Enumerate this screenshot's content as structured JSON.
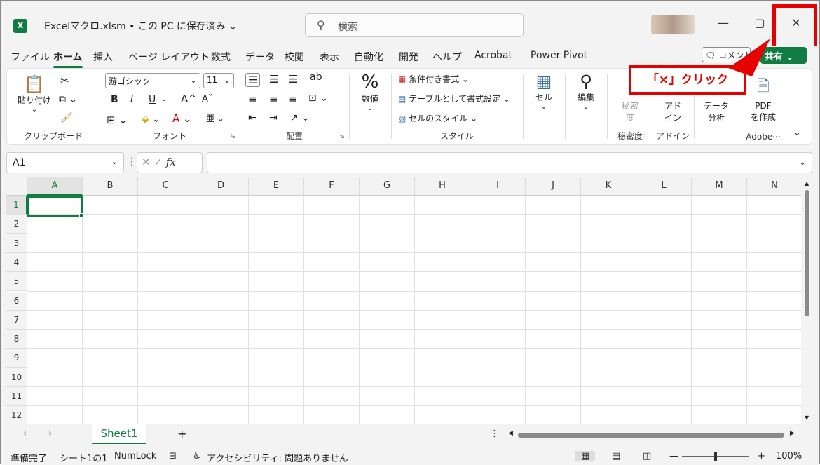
{
  "titlebar": {
    "app_icon": "X",
    "document_title": "Excelマクロ.xlsm • この PC に保存済み ⌄",
    "search_placeholder": "検索",
    "minimize": "—",
    "maximize": "▢",
    "close": "✕"
  },
  "menu": {
    "tabs": [
      "ファイル",
      "ホーム",
      "挿入",
      "ページ レイアウト",
      "数式",
      "データ",
      "校閲",
      "表示",
      "自動化",
      "開発",
      "ヘルプ",
      "Acrobat",
      "Power Pivot"
    ],
    "active": "ホーム",
    "comment_label": "コメント",
    "share_label": "共有 ⌄"
  },
  "callout": {
    "text": "「×」クリック",
    "color": "#e60000"
  },
  "ribbon": {
    "clipboard": {
      "paste": "貼り付け",
      "label": "クリップボード"
    },
    "font": {
      "font_name": "游ゴシック",
      "font_size": "11",
      "bold": "B",
      "italic": "I",
      "underline": "U",
      "grow": "A^",
      "shrink": "Aˇ",
      "label": "フォント"
    },
    "alignment": {
      "label": "配置"
    },
    "number": {
      "symbol": "%",
      "name": "数値"
    },
    "styles": {
      "conditional": "条件付き書式 ⌄",
      "table": "テーブルとして書式設定 ⌄",
      "cellstyle": "セルのスタイル ⌄",
      "label": "スタイル"
    },
    "cells": {
      "name": "セル"
    },
    "editing": {
      "name": "編集"
    },
    "sensitivity": {
      "name1": "秘密",
      "name2": "度",
      "label": "秘密度"
    },
    "addins": {
      "name1": "アド",
      "name2": "イン",
      "label": "アドイン"
    },
    "analysis": {
      "name1": "データ",
      "name2": "分析"
    },
    "pdf": {
      "name1": "PDF",
      "name2": "を作成",
      "label": "Adobe···"
    }
  },
  "formula_bar": {
    "name_box": "A1",
    "fx": "fx"
  },
  "grid": {
    "columns": [
      "A",
      "B",
      "C",
      "D",
      "E",
      "F",
      "G",
      "H",
      "I",
      "J",
      "K",
      "L",
      "M",
      "N"
    ],
    "rows": [
      "1",
      "2",
      "3",
      "4",
      "5",
      "6",
      "7",
      "8",
      "9",
      "10",
      "11",
      "12"
    ],
    "selected_cell": "A1"
  },
  "sheets": {
    "tabs": [
      "Sheet1"
    ],
    "add": "+"
  },
  "status": {
    "ready": "準備完了",
    "sheet_info": "シート1の1",
    "numlock": "NumLock",
    "accessibility": "アクセシビリティ: 問題ありません",
    "zoom": "100%",
    "zoom_minus": "—",
    "zoom_plus": "+"
  }
}
